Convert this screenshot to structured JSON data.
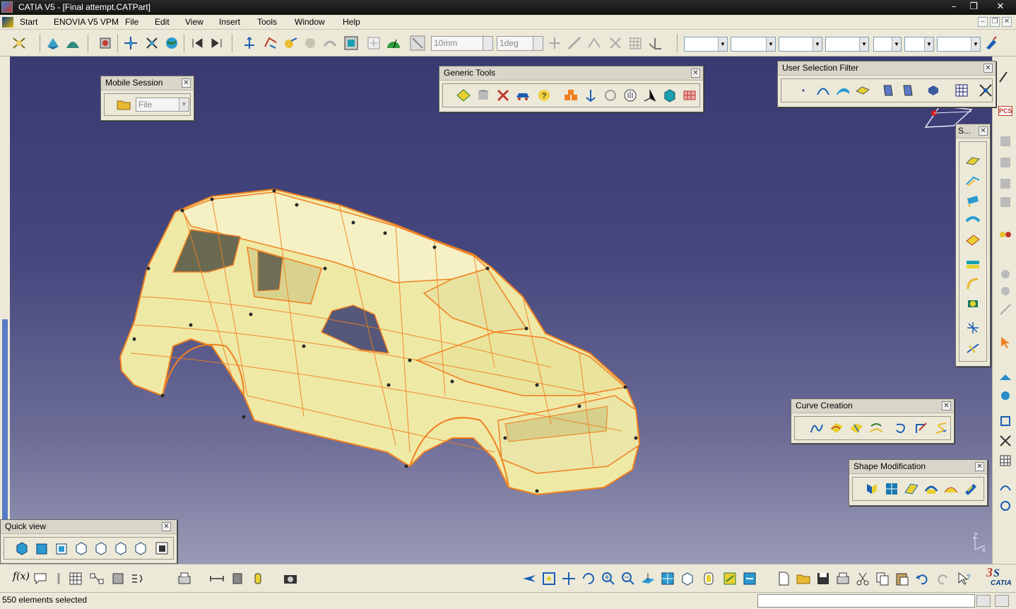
{
  "window": {
    "title": "CATIA V5 - [Final attempt.CATPart]"
  },
  "menu": {
    "items": [
      "Start",
      "ENOVIA V5 VPM",
      "File",
      "Edit",
      "View",
      "Insert",
      "Tools",
      "Window",
      "Help"
    ]
  },
  "toolbar": {
    "snap_distance": "10mm",
    "snap_angle": "1deg"
  },
  "panels": {
    "mobile_session": {
      "title": "Mobile Session",
      "combo_value": "File"
    },
    "generic_tools": {
      "title": "Generic Tools"
    },
    "user_selection_filter": {
      "title": "User Selection Filter"
    },
    "s_panel": {
      "title": "S..."
    },
    "curve_creation": {
      "title": "Curve Creation"
    },
    "shape_modification": {
      "title": "Shape Modification"
    },
    "quick_view": {
      "title": "Quick view"
    }
  },
  "status": {
    "text": "550 elements selected"
  },
  "logo": {
    "text": "CATIA"
  },
  "compass_label": "PCS",
  "axis": {
    "z": "Z",
    "x": "x"
  },
  "colors": {
    "viewport_top": "#3a3a72",
    "model_fill": "#efe9a6",
    "model_edges": "#f07f1f"
  }
}
